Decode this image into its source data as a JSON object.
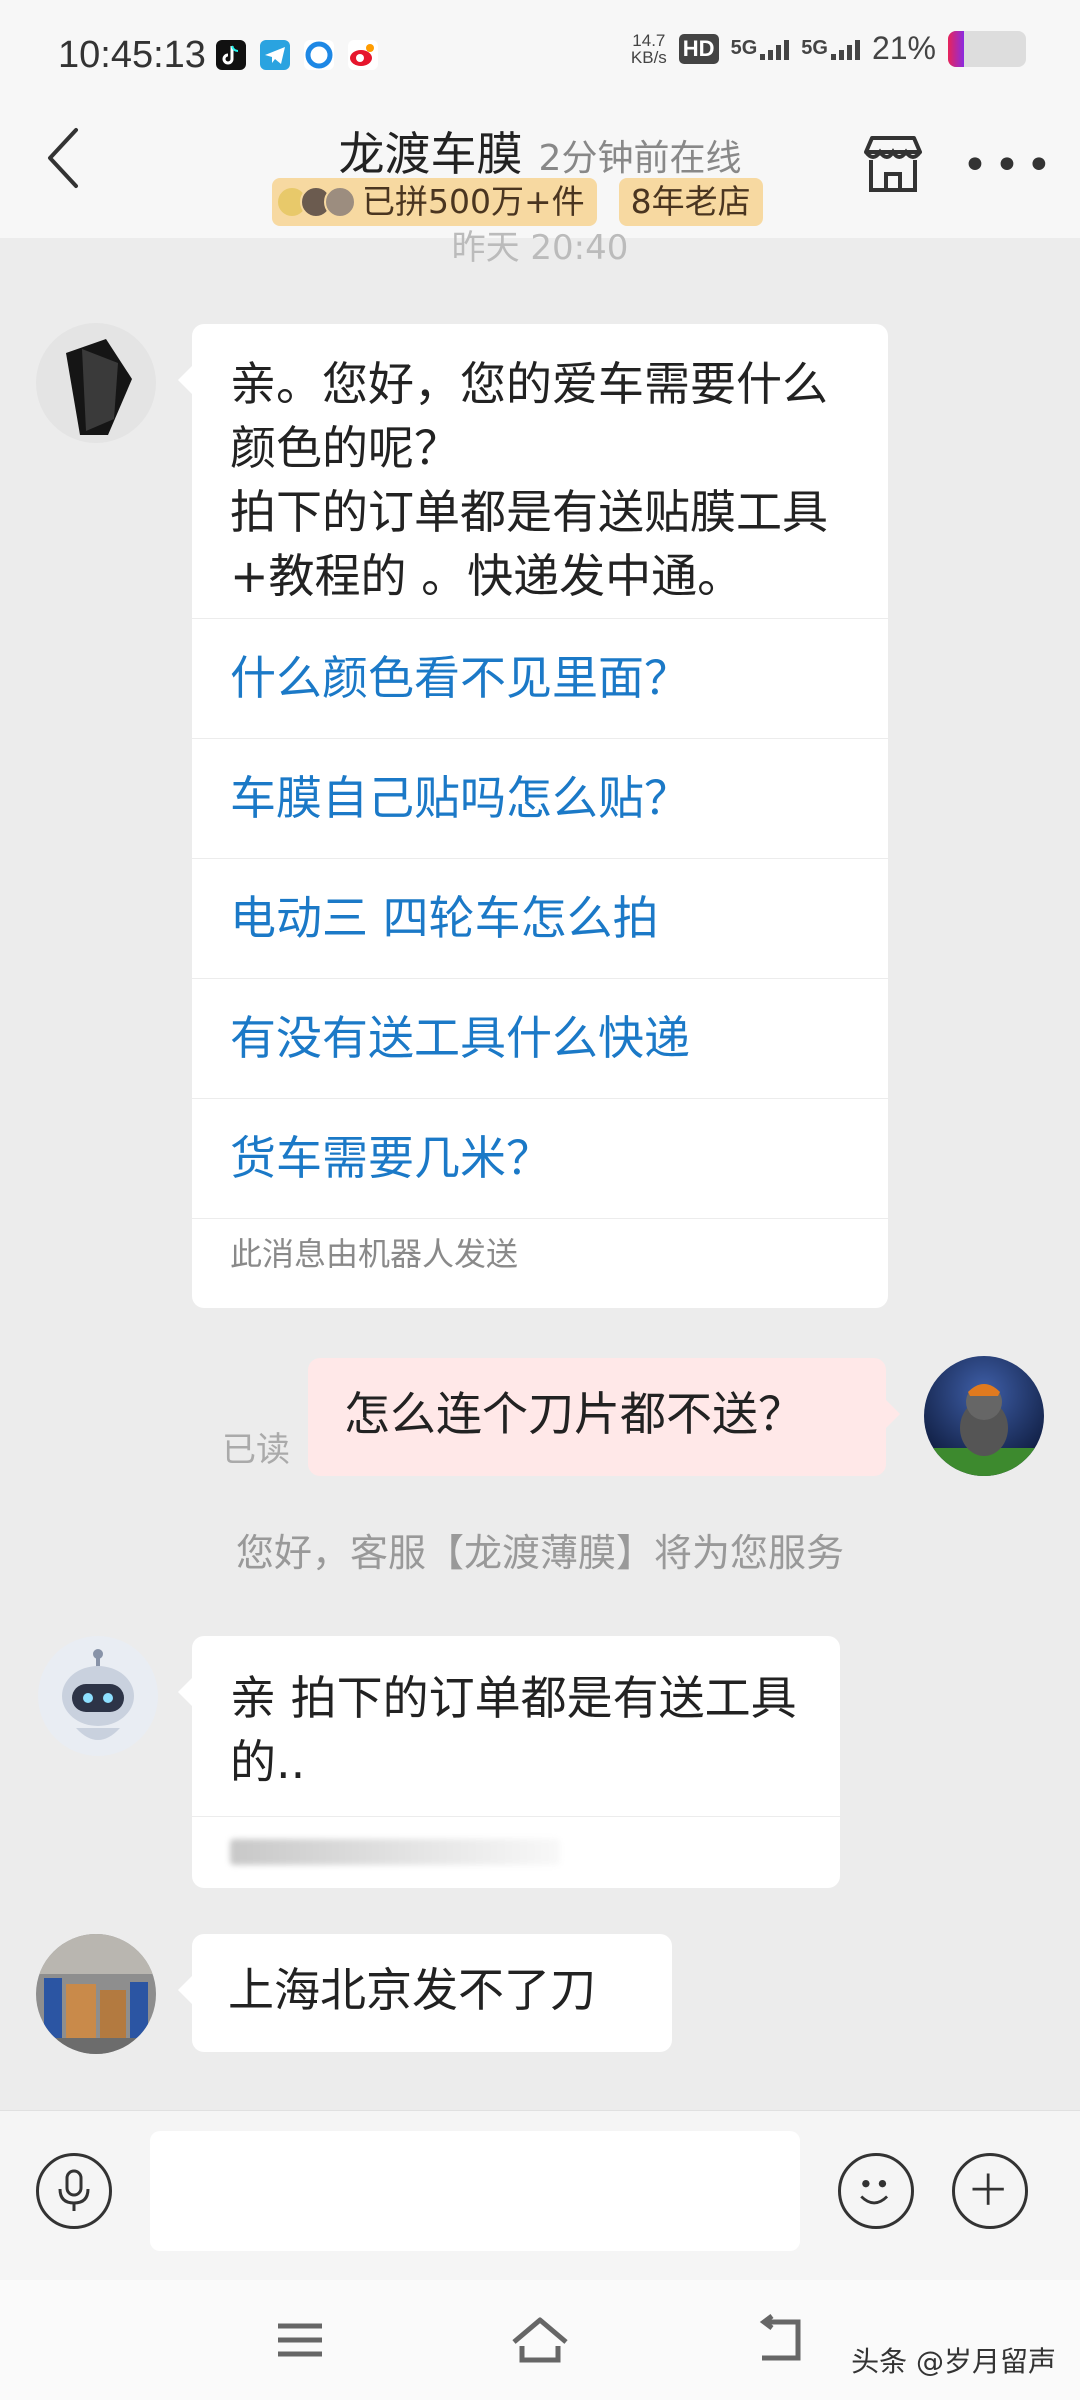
{
  "status_bar": {
    "time": "10:45:13",
    "app_icons": [
      "tiktok-icon",
      "telegram-icon",
      "browser-icon",
      "weibo-icon"
    ],
    "net_speed_value": "14.7",
    "net_speed_unit": "KB/s",
    "hd_label": "HD",
    "network_1": "5G",
    "network_2": "5G",
    "battery_pct": "21%",
    "battery_level": 0.21
  },
  "header": {
    "title": "龙渡车膜",
    "online_status": "2分钟前在线",
    "badge_sales": "已拼500万+件",
    "badge_store_age": "8年老店"
  },
  "timestamp": "昨天 20:40",
  "messages": {
    "bot_greeting": {
      "text": "亲。您好，您的爱车需要什么颜色的呢？\n拍下的订单都是有送贴膜工具+教程的 。快递发中通。",
      "questions": [
        "什么颜色看不见里面？",
        "车膜自己贴吗怎么贴？",
        "电动三 四轮车怎么拍",
        "有没有送工具什么快递",
        "货车需要几米？"
      ],
      "robot_note": "此消息由机器人发送"
    },
    "user_msg": {
      "text": "怎么连个刀片都不送？",
      "read_status": "已读"
    },
    "system_note": "您好，客服【龙渡薄膜】将为您服务",
    "robot_reply": {
      "text": "亲 拍下的订单都是有送工具的.."
    },
    "seller_reply": {
      "text": "上海北京发不了刀"
    }
  },
  "input": {
    "placeholder": ""
  },
  "watermark": "头条 @岁月留声",
  "colors": {
    "link_blue": "#1b79c7",
    "badge_bg": "#f7d9a1",
    "my_bubble": "#ffe8e8",
    "chat_bg": "#ececec"
  }
}
